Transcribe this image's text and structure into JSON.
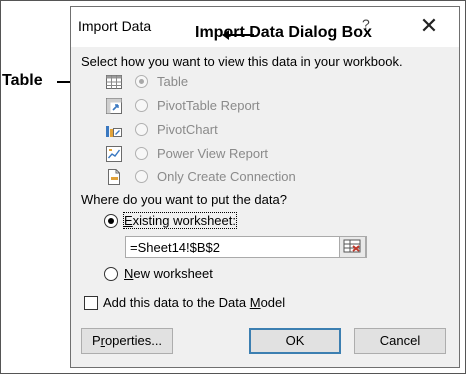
{
  "dialog": {
    "title": "Import Data",
    "help": "?",
    "close": "✕",
    "prompt_view": "Select how you want to view this data in your workbook.",
    "view_options": [
      {
        "label": "Table",
        "selected": true
      },
      {
        "label": "PivotTable Report",
        "selected": false
      },
      {
        "label": "PivotChart",
        "selected": false
      },
      {
        "label": "Power View Report",
        "selected": false
      },
      {
        "label": "Only Create Connection",
        "selected": false
      }
    ],
    "prompt_put": "Where do you want to put the data?",
    "existing_ws": {
      "access": "E",
      "rest": "xisting worksheet:"
    },
    "reference": "=Sheet14!$B$2",
    "new_ws": {
      "access": "N",
      "rest": "ew worksheet"
    },
    "data_model": {
      "before": "Add this data to the Data ",
      "access": "M",
      "after": "odel"
    },
    "buttons": {
      "properties": {
        "before": "P",
        "access": "r",
        "after": "operties..."
      },
      "ok": "OK",
      "cancel": "Cancel"
    }
  },
  "annotations": {
    "dialog_box": "Import Data Dialog Box",
    "table": "Table"
  }
}
